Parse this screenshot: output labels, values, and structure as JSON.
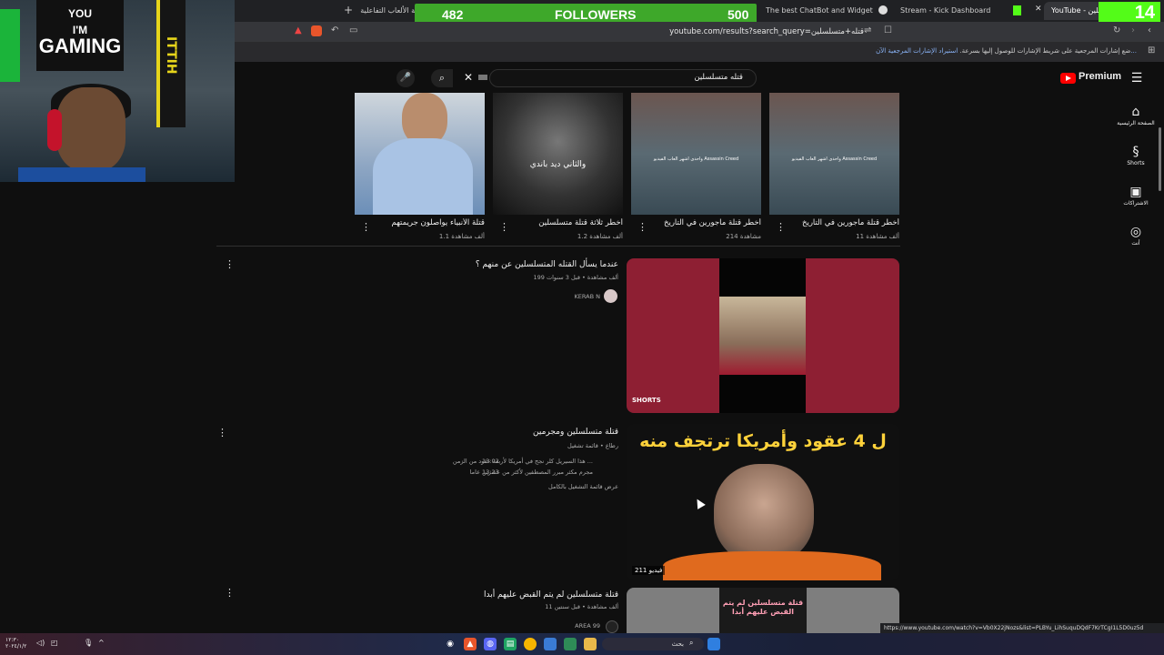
{
  "browser": {
    "tabs": [
      {
        "label": "منصة الألعاب التفاعلية"
      },
      {
        "label": "The best ChatBot and Widgets for Ki"
      },
      {
        "label": "Stream - Kick Dashboard"
      },
      {
        "label": "YouTube - قتله متسلسلين"
      }
    ],
    "url": "youtube.com/results?search_query=قتله+متسلسلين",
    "bookmark_text": "ضع إشارات المرجعية على شريط الإشارات للوصول إليها بسرعة.",
    "bookmark_link": "استيراد الإشارات المرجعية الآن...",
    "status_url": "https://www.youtube.com/watch?v=Vb0X22jNozs&list=PLBYu_LihSuquDQdF7KrTCgI1L5D0uz5d"
  },
  "overlay": {
    "followers_current": "482",
    "followers_label": "FOLLOWERS",
    "followers_goal": "500",
    "kick_count": "14",
    "poster_line1": "YOU",
    "poster_line2": "I'M",
    "poster_line3": "GAMING",
    "banner_text": "ITTIH"
  },
  "youtube": {
    "logo": "Premium",
    "search_query": "قتله متسلسلين",
    "sidebar": [
      {
        "label": "الصفحة الرئيسية",
        "icon": "home-icon"
      },
      {
        "label": "Shorts",
        "icon": "shorts-icon"
      },
      {
        "label": "الاشتراكات",
        "icon": "subscriptions-icon"
      },
      {
        "label": "أنت",
        "icon": "you-icon"
      }
    ],
    "shelf": [
      {
        "title": "قتلة الأنبياء يواصلون جريمتهم",
        "views": "1.1 ألف مشاهدة"
      },
      {
        "title": "أخطر ثلاثة قتلة متسلسلين",
        "views": "1.2 ألف مشاهدة",
        "overlay": "والثاني ديد باندي"
      },
      {
        "title": "أخطر قتلة مأجورين في التاريخ",
        "views": "214 مشاهدة",
        "overlay": "واحدى اشهر العاب الفيديو Assassin Creed"
      },
      {
        "title": "أخطر قتلة مأجورين في التاريخ",
        "views": "11 ألف مشاهدة",
        "overlay": "واحدى اشهر العاب الفيديو Assassin Creed"
      }
    ],
    "results": [
      {
        "title": "عندما يسأل القتله المتسلسلين عن منهم ؟",
        "meta": "199 ألف مشاهدة • قبل 3 سنوات",
        "channel": "KERAB N",
        "badge": "SHORTS"
      },
      {
        "title": "قتلة متسلسلين ومجرمين",
        "meta": "رطاع • قائمة تشغيل",
        "line1": "هذا السيريل كلر نجح في أمريكا لأربعة عقود من الزمن ...",
        "line2": "مجرم مكثر مبرر المصطفين لأكثر من عشرين عاما",
        "time1": "13:02",
        "time2": "13:23",
        "playlist_link": "عرض قائمة التشغيل بالكامل",
        "thumb_text": "ل 4 عقود وأمريكا ترتجف منه",
        "count": "211 فيديو"
      },
      {
        "title": "قتلة متسلسلين لم يتم القبض عليهم أبدا",
        "meta": "11 ألف مشاهدة • قبل سنتين",
        "channel": "AREA 99",
        "thumb_text": "قتلة متسلسلين لم يتم القبض عليهم أبدا"
      }
    ]
  },
  "taskbar": {
    "search_placeholder": "بحث",
    "clock": "١٢:٣٠",
    "date": "٢٠٢٤/١/٢"
  }
}
